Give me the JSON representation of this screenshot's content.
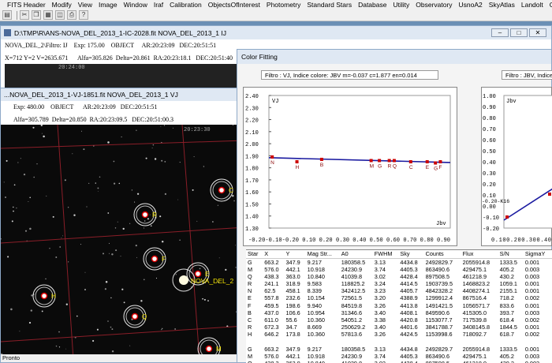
{
  "menu": [
    "FITS Header",
    "Modify",
    "View",
    "Image",
    "Window",
    "Iraf",
    "Calibration",
    "ObjectsOfInterest",
    "Photometry",
    "Standard Stars",
    "Database",
    "Utility",
    "Observatory",
    "UsnoA2",
    "SkyAtlas",
    "Landolt",
    "Comparison Sequ"
  ],
  "win1": {
    "title": "D:\\TMP\\R\\ANS-NOVA_DEL_2013_1-IC-2028.fit   NOVA_DEL_2013_1   IJ",
    "row1": [
      "NOVA_DEL_2\\Filtro: IJ",
      "Exp: 175.00",
      "OBJECT",
      "AR:20:23:09",
      "DEC:20:51:51"
    ],
    "row2": [
      "X=712 Y=2 V=2635.671",
      "Alfa=305.826",
      "Delta=20.861",
      "RA:20:23:18.1",
      "DEC:20:51:40"
    ],
    "ra_label": "20:24:00"
  },
  "win2": {
    "title": "...NOVA_DEL_2013_1-VJ-1851.fit   NOVA_DEL_2013_1   VJ",
    "row1": [
      "Exp: 480.00",
      "OBJECT",
      "AR:20:23:09",
      "DEC:20:51:51"
    ],
    "row2": [
      "Alfa=305.789",
      "Delta=20.850",
      "RA:20:23:09.5",
      "DEC:20:51:00.3"
    ],
    "ra_label": "20:23:30",
    "status": "Pronto",
    "nova_label": "NOVA_DEL_2"
  },
  "stars": [
    {
      "id": "C",
      "x": 280,
      "y": 83
    },
    {
      "id": "R",
      "x": 183,
      "y": 114
    },
    {
      "id": "F",
      "x": 195,
      "y": 170
    },
    {
      "id": "E",
      "x": 250,
      "y": 189
    },
    {
      "id": "H",
      "x": 55,
      "y": 217
    },
    {
      "id": "Q",
      "x": 170,
      "y": 243
    },
    {
      "id": "M",
      "x": 264,
      "y": 284
    }
  ],
  "color_fitting": {
    "title": "Color Fitting",
    "fit1": "Filtro : VJ,  Indice colore: JBV m=-0.037 c=1.877 en=0.014",
    "fit2": "Filtro : JBV,  Indice co",
    "plot1": {
      "y_label": "VJ",
      "x_label": "Jbv",
      "y_ticks": [
        "2.40",
        "2.30",
        "2.20",
        "2.10",
        "2.00",
        "1.90",
        "1.80",
        "1.70",
        "1.60",
        "1.50",
        "1.40",
        "1.30"
      ],
      "x_ticks": "-0.20-0.10-0.20 0.10 0.20 0.30 0.40 0.50 0.60 0.70 0.80 0.90",
      "points": [
        {
          "id": "N",
          "bv": -0.18,
          "v": 1.89
        },
        {
          "id": "H",
          "bv": -0.03,
          "v": 1.85
        },
        {
          "id": "B",
          "bv": 0.12,
          "v": 1.87
        },
        {
          "id": "M",
          "bv": 0.42,
          "v": 1.86
        },
        {
          "id": "G",
          "bv": 0.47,
          "v": 1.86
        },
        {
          "id": "R",
          "bv": 0.53,
          "v": 1.86
        },
        {
          "id": "Q",
          "bv": 0.56,
          "v": 1.86
        },
        {
          "id": "C",
          "bv": 0.66,
          "v": 1.85
        },
        {
          "id": "E",
          "bv": 0.76,
          "v": 1.85
        },
        {
          "id": "G",
          "bv": 0.81,
          "v": 1.84
        },
        {
          "id": "F",
          "bv": 0.84,
          "v": 1.85
        }
      ]
    },
    "plot2": {
      "y_label": "Jbv",
      "y_ticks": [
        "1.00",
        "0.90",
        "0.80",
        "0.70",
        "0.60",
        "0.50",
        "0.40",
        "0.30",
        "0.20",
        "0.10",
        "0.00",
        "-0.10",
        "-0.20"
      ],
      "x_ticks": "0.100.200.300.40",
      "line_mark": "-0.20-K16"
    }
  },
  "table": {
    "headers": [
      "Star",
      "X",
      "Y",
      "Mag Str...",
      "A0",
      "FWHM",
      "Sky",
      "Counts",
      "Flux",
      "S/N",
      "SigmaY"
    ],
    "rows": [
      [
        "G",
        "663.2",
        "347.9",
        "9.217",
        "180358.5",
        "3.13",
        "4434.8",
        "2492829.7",
        "2055914.8",
        "1333.5",
        "0.001"
      ],
      [
        "M",
        "576.0",
        "442.1",
        "10.918",
        "24230.9",
        "3.74",
        "4405.3",
        "863490.6",
        "429475.1",
        "405.2",
        "0.003"
      ],
      [
        "Q",
        "438.3",
        "363.0",
        "10.840",
        "41039.8",
        "3.02",
        "4428.4",
        "897508.5",
        "461218.9",
        "430.2",
        "0.003"
      ],
      [
        "R",
        "241.1",
        "318.9",
        "9.583",
        "118825.2",
        "3.24",
        "4414.5",
        "1903739.5",
        "1468823.2",
        "1059.1",
        "0.001"
      ],
      [
        "N",
        "62.5",
        "458.1",
        "8.339",
        "342412.5",
        "3.23",
        "4405.7",
        "4842328.2",
        "4408274.1",
        "2155.1",
        "0.001"
      ],
      [
        "E",
        "557.8",
        "232.6",
        "10.154",
        "72561.5",
        "3.20",
        "4388.9",
        "1299912.4",
        "867516.4",
        "718.2",
        "0.002"
      ],
      [
        "F",
        "459.5",
        "198.6",
        "9.940",
        "84519.8",
        "3.26",
        "4413.8",
        "1491421.5",
        "1056571.7",
        "833.6",
        "0.001"
      ],
      [
        "B",
        "437.0",
        "106.6",
        "10.954",
        "31346.6",
        "3.40",
        "4408.1",
        "849590.6",
        "415305.0",
        "393.7",
        "0.003"
      ],
      [
        "C",
        "611.0",
        "55.6",
        "10.360",
        "54051.2",
        "3.38",
        "4420.8",
        "1153077.7",
        "717539.8",
        "618.4",
        "0.002"
      ],
      [
        "R",
        "672.3",
        "34.7",
        "8.669",
        "250629.2",
        "3.40",
        "4401.6",
        "3841788.7",
        "3408145.8",
        "1844.5",
        "0.001"
      ],
      [
        "H",
        "646.2",
        "173.8",
        "10.360",
        "57813.6",
        "3.26",
        "4424.5",
        "1153998.6",
        "718092.7",
        "618.7",
        "0.002"
      ],
      [
        "",
        "",
        "",
        "",
        "",
        "",
        "",
        "",
        "",
        "",
        ""
      ],
      [
        "G",
        "663.2",
        "347.9",
        "9.217",
        "180358.5",
        "3.13",
        "4434.8",
        "2492829.7",
        "2055914.8",
        "1333.5",
        "0.001"
      ],
      [
        "M",
        "576.0",
        "442.1",
        "10.918",
        "24230.9",
        "3.74",
        "4405.3",
        "863490.6",
        "429475.1",
        "405.2",
        "0.003"
      ],
      [
        "Q",
        "438.3",
        "363.0",
        "10.840",
        "41039.8",
        "3.02",
        "4428.4",
        "897508.5",
        "461218.9",
        "430.2",
        "0.003"
      ]
    ]
  }
}
